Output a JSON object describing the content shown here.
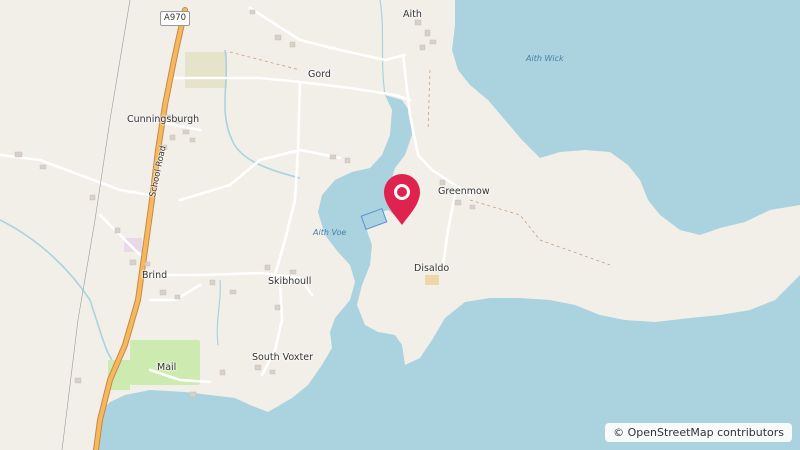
{
  "map": {
    "places": [
      {
        "name": "Aith"
      },
      {
        "name": "Gord"
      },
      {
        "name": "Cunningsburgh"
      },
      {
        "name": "Greenmow"
      },
      {
        "name": "Disaldo"
      },
      {
        "name": "Brind"
      },
      {
        "name": "Skibhoull"
      },
      {
        "name": "South Voxter"
      },
      {
        "name": "Mail"
      }
    ],
    "water": [
      {
        "name": "Aith Wick"
      },
      {
        "name": "Aith Voe"
      }
    ],
    "roads": {
      "shield": "A970",
      "street": "School Road"
    },
    "marker": {
      "icon": "map-pin-icon",
      "color": "#e0234e"
    },
    "colors": {
      "land": "#f2efe9",
      "water": "#aad3df",
      "road_major": "#f5b95b",
      "park": "#cdebb0"
    }
  },
  "attribution": {
    "symbol": "©",
    "text": "OpenStreetMap contributors"
  }
}
